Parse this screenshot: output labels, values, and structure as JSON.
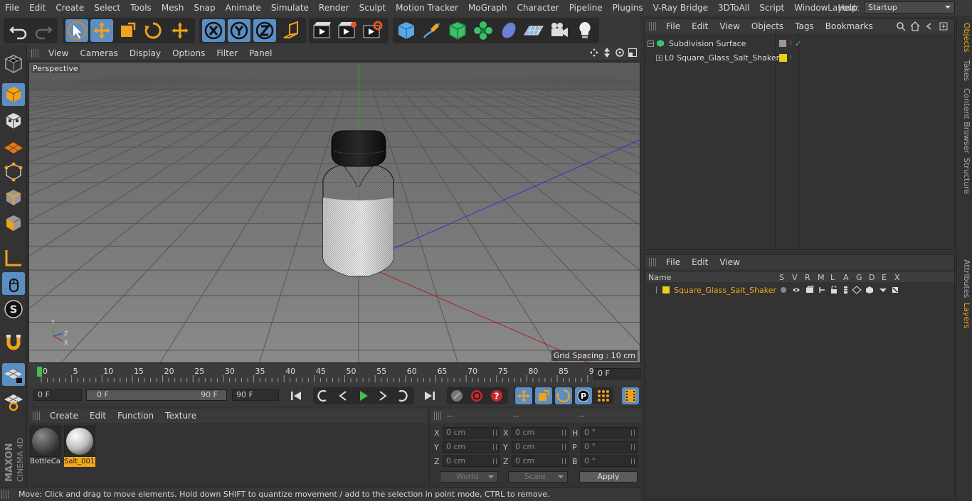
{
  "menu": {
    "items": [
      "File",
      "Edit",
      "Create",
      "Select",
      "Tools",
      "Mesh",
      "Snap",
      "Animate",
      "Simulate",
      "Render",
      "Sculpt",
      "Motion Tracker",
      "MoGraph",
      "Character",
      "Pipeline",
      "Plugins",
      "V-Ray Bridge",
      "3DToAll",
      "Script",
      "Window",
      "Help"
    ],
    "layout_label": "Layout:",
    "layout_value": "Startup"
  },
  "viewport": {
    "menu": [
      "View",
      "Cameras",
      "Display",
      "Options",
      "Filter",
      "Panel"
    ],
    "label": "Perspective",
    "grid_spacing": "Grid Spacing : 10 cm",
    "axis_y": "Y",
    "axis_z": "Z",
    "axis_x": "X"
  },
  "timeline": {
    "ticks": [
      "0",
      "5",
      "10",
      "15",
      "20",
      "25",
      "30",
      "35",
      "40",
      "45",
      "50",
      "55",
      "60",
      "65",
      "70",
      "75",
      "80",
      "85",
      "90"
    ],
    "current_frame_right": "0 F",
    "start_frame": "0 F",
    "range_start": "0 F",
    "range_end": "90 F",
    "end_frame": "90 F"
  },
  "materials": {
    "menu": [
      "Create",
      "Edit",
      "Function",
      "Texture"
    ],
    "items": [
      {
        "label": "BottleCa",
        "selected": false
      },
      {
        "label": "Salt_001",
        "selected": true
      }
    ]
  },
  "coords": {
    "headers": [
      "--",
      "--",
      "--"
    ],
    "rows": [
      {
        "l1": "X",
        "v1": "0 cm",
        "l2": "X",
        "v2": "0 cm",
        "l3": "H",
        "v3": "0 °"
      },
      {
        "l1": "Y",
        "v1": "0 cm",
        "l2": "Y",
        "v2": "0 cm",
        "l3": "P",
        "v3": "0 °"
      },
      {
        "l1": "Z",
        "v1": "0 cm",
        "l2": "Z",
        "v2": "0 cm",
        "l3": "B",
        "v3": "0 °"
      }
    ],
    "dropdown1": "World",
    "dropdown2": "Scale",
    "apply": "Apply"
  },
  "status": "Move: Click and drag to move elements. Hold down SHIFT to quantize movement / add to the selection in point mode, CTRL to remove.",
  "objects": {
    "menu": [
      "File",
      "Edit",
      "View",
      "Objects",
      "Tags",
      "Bookmarks"
    ],
    "items": [
      {
        "name": "Subdivision Surface"
      },
      {
        "name": "Square_Glass_Salt_Shaker"
      }
    ]
  },
  "layers": {
    "menu": [
      "File",
      "Edit",
      "View"
    ],
    "headers": [
      "Name",
      "S",
      "V",
      "R",
      "M",
      "L",
      "A",
      "G",
      "D",
      "E",
      "X"
    ],
    "rows": [
      {
        "name": "Square_Glass_Salt_Shaker",
        "color": "#e5d21a"
      }
    ]
  },
  "side_tabs": {
    "top": [
      "Objects",
      "Takes",
      "Content Browser",
      "Structure"
    ],
    "bottom": [
      "Attributes",
      "Layers"
    ]
  },
  "brand": {
    "line1": "MAXON",
    "line2": "CINEMA 4D"
  },
  "colors": {
    "accent": "#f1a81a",
    "active_blue": "#5b8ec2"
  }
}
